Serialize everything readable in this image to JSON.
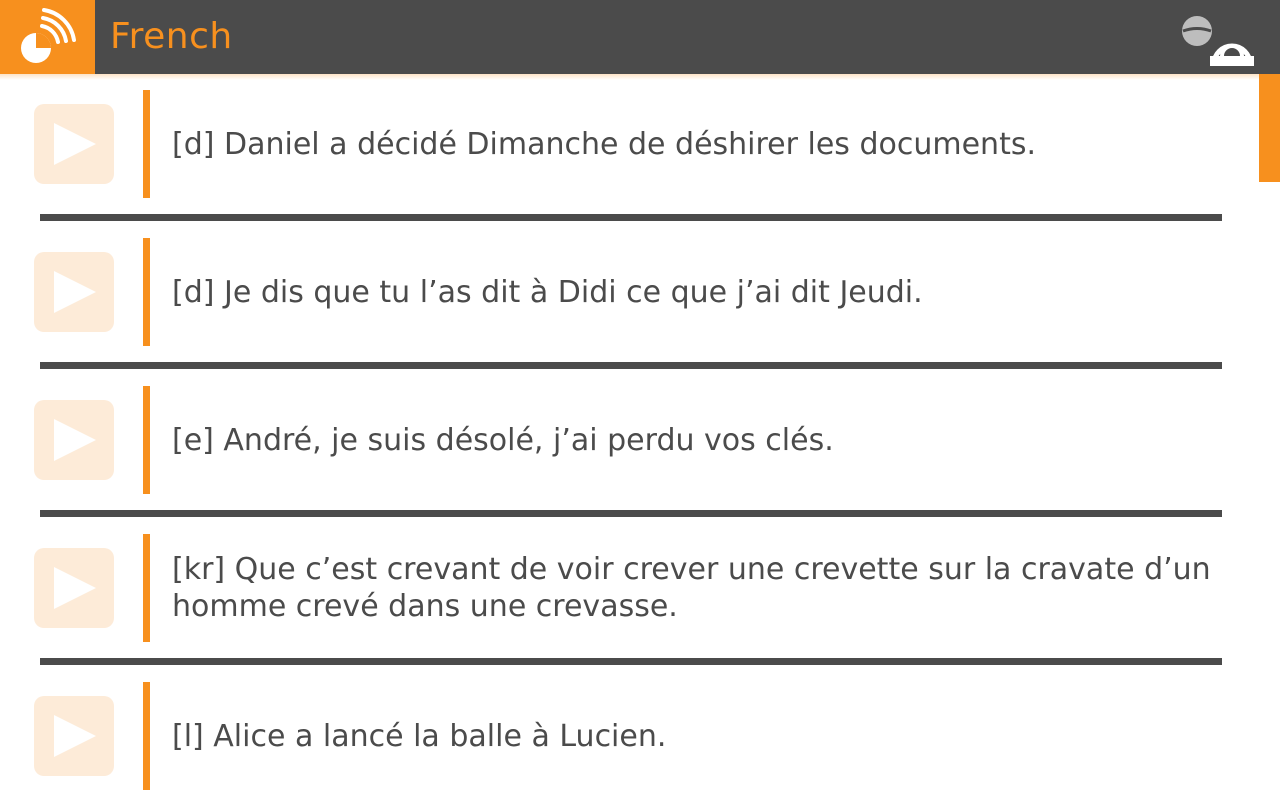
{
  "header": {
    "title": "French",
    "logo_icon": "speech-wave-icon",
    "night_mode_icon": "moon-icon",
    "audio_icon": "headset-icon"
  },
  "colors": {
    "accent": "#f7901e",
    "header_bg": "#4b4b4b",
    "text": "#4b4b4b",
    "play_tile": "#fdebd8"
  },
  "phrases": [
    {
      "text": "[d] Daniel a décidé Dimanche de déshirer les documents."
    },
    {
      "text": "[d] Je dis que tu l’as dit à Didi ce que j’ai dit Jeudi."
    },
    {
      "text": "[e] André, je suis désolé, j’ai perdu vos clés."
    },
    {
      "text": "[kr] Que c’est crevant de voir crever une crevette sur la cravate d’un homme crevé dans une crevasse."
    },
    {
      "text": "[l] Alice a lancé la balle à Lucien."
    }
  ]
}
